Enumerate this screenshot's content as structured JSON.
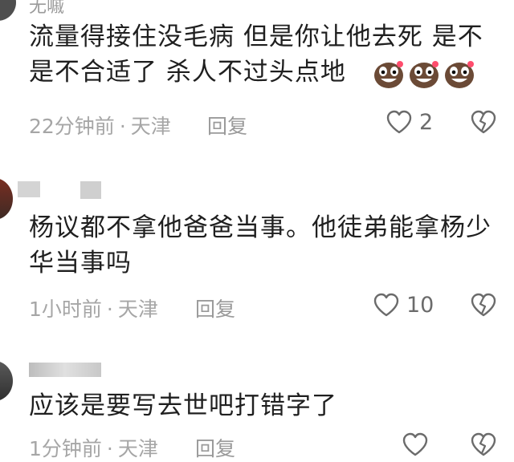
{
  "comments": [
    {
      "username": "无嘁",
      "text": "流量得接住没毛病  但是你让他去死  是不是不合适了  杀人不过头点地",
      "emojis": [
        "laughing-face-emoji",
        "laughing-face-emoji",
        "laughing-face-emoji"
      ],
      "time": "22分钟前",
      "location": "天津",
      "reply_label": "回复",
      "likes": "2"
    },
    {
      "username": "",
      "text": "杨议都不拿他爸爸当事。他徒弟能拿杨少华当事吗",
      "time": "1小时前",
      "location": "天津",
      "reply_label": "回复",
      "likes": "10"
    },
    {
      "username": "",
      "text": "应该是要写去世吧打错字了",
      "time": "1分钟前",
      "location": "天津",
      "reply_label": "回复",
      "likes": ""
    }
  ],
  "separator": "·",
  "icons": {
    "like": "heart-outline-icon",
    "dislike": "broken-heart-icon"
  },
  "colors": {
    "text": "#1f1f1f",
    "meta": "#a6a6a6",
    "icon": "#6b6b6b"
  }
}
